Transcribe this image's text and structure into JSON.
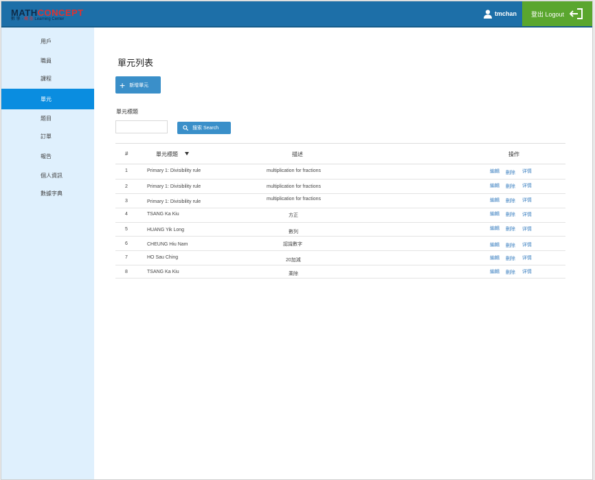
{
  "header": {
    "logo_line1_a": "MATH",
    "logo_line1_b": "CONCEPT",
    "logo_line2_a": "數 學 ·",
    "logo_line2_b": "概 念",
    "logo_line2_c": "Learning Center",
    "username": "tmchan",
    "logout_label": "登出 Logout",
    "colors": {
      "header": "#1d6fa8",
      "logout": "#5aa62e",
      "sidebar_active": "#0a8de0"
    }
  },
  "sidebar": {
    "items": [
      {
        "label": "用戶",
        "active": false
      },
      {
        "label": "職員",
        "active": false
      },
      {
        "label": "課程",
        "active": false
      },
      {
        "label": "單元",
        "active": true
      },
      {
        "label": "題目",
        "active": false
      },
      {
        "label": "訂單",
        "active": false
      },
      {
        "label": "報告",
        "active": false
      },
      {
        "label": "個人資訊",
        "active": false
      },
      {
        "label": "數據字典",
        "active": false
      }
    ]
  },
  "main": {
    "title": "單元列表",
    "add_button": "新增單元",
    "filter_label": "單元標題",
    "search_value": "",
    "search_button": "搜索 Search",
    "table": {
      "headers": [
        "#",
        "單元標題",
        "描述",
        "操作"
      ],
      "rows": [
        {
          "num": "1",
          "title": "Primary 1: Divisibility rule",
          "desc": "multiplication for fractions",
          "edit": "編輯",
          "del": "刪除",
          "detail": "详情"
        },
        {
          "num": "2",
          "title": "Primary 1: Divisibility rule",
          "desc": "multiplication for fractions",
          "edit": "編輯",
          "del": "刪除",
          "detail": "详情"
        },
        {
          "num": "3",
          "title": "Primary 1: Divisibility rule",
          "desc": "multiplication for fractions",
          "edit": "編輯",
          "del": "刪除",
          "detail": "详情"
        },
        {
          "num": "4",
          "title": "TSANG Ka Kiu",
          "desc": "方正",
          "edit": "編輯",
          "del": "刪除",
          "detail": "详情"
        },
        {
          "num": "5",
          "title": "HUANG Yik Long",
          "desc": "數列",
          "edit": "編輯",
          "del": "刪除",
          "detail": "详情"
        },
        {
          "num": "6",
          "title": "CHEUNG Hiu Nam",
          "desc": "認識數字",
          "edit": "編輯",
          "del": "刪除",
          "detail": "详情"
        },
        {
          "num": "7",
          "title": "HO Sau Ching",
          "desc": "20加減",
          "edit": "編輯",
          "del": "刪除",
          "detail": "详情"
        },
        {
          "num": "8",
          "title": "TSANG Ka Kiu",
          "desc": "乘除",
          "edit": "編輯",
          "del": "刪除",
          "detail": "详情"
        }
      ]
    }
  }
}
